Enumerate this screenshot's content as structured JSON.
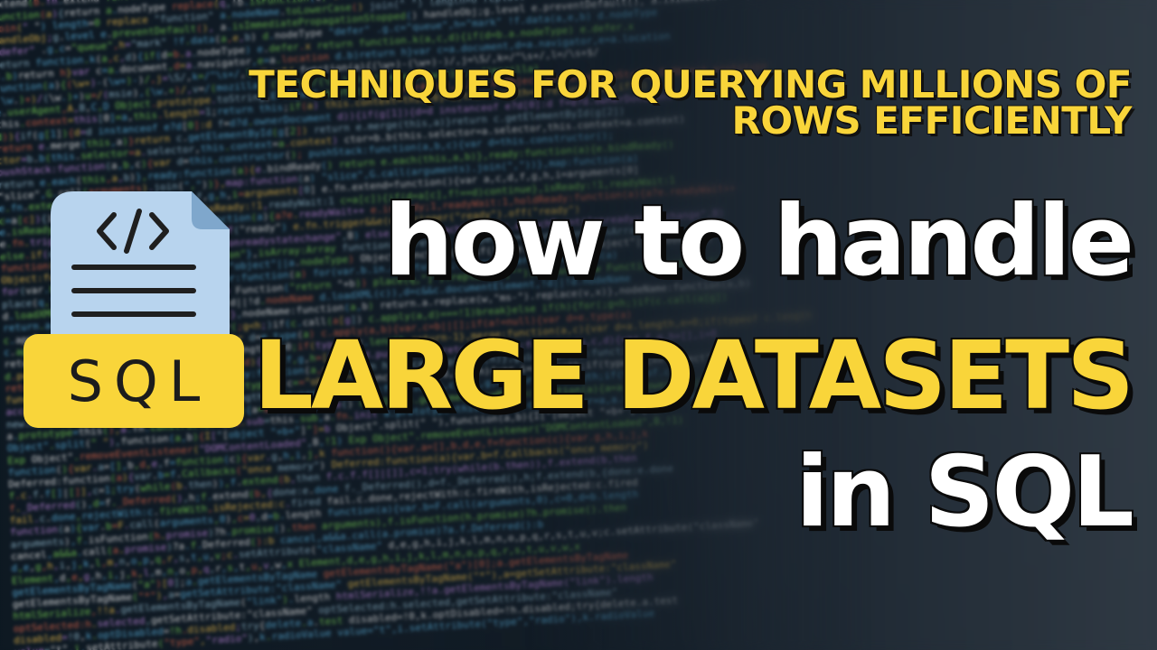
{
  "thumbnail": {
    "subtitle_line1": "TECHNIQUES FOR QUERYING MILLIONS OF",
    "subtitle_line2": "ROWS EFFICIENTLY",
    "title_line1": "how to handle",
    "title_line2": "LARGE DATASETS",
    "title_line3": "in SQL"
  },
  "icon": {
    "name": "sql-file-icon",
    "code_glyph": "</>",
    "label": "SQL"
  },
  "background": {
    "code_lines": [
      "ributes(b.?b.mergeAttributes b.defaultValue b.checked if(g)delete e.checked",
      "extend(b.fn.extend function(a){return a.appendChild a.handle e.events",
      "function(a){return a.nodeType replace(q,!b.isFunction(c) a.ownerDocument",
      "join(\" \") length=0 replace \"function\" a.nodeName.toLowerCase()",
      "handleObj;g.level e.preventDefault(), a.isImmediatePropagationStopped()",
      "\"defer\" .g.c=\"queue\",h=\"mark\" !f.data(a,e,b) d.nodeType",
      "return function.k(a,c,d){if(d=b.a.nodeType) e.defer.x",
      "d.b)return h}var c=a.document,d=a.navigator,e=a.location",
      "function(a){(\\w+)-(\\w+)-)/,j=\\S/,k=/^\\s+/,l=/\\s+$/",
      "(\\w.)+)/(\\w.)+)u=/(msie),(\\w.+)/,v=/(mozilla)",
      "e.userAgent,A,B,C,D Object.prototype.toString,E Object.prototype",
      "this.context=this[0]=a,this.length=1;return this;if(a)",
      "d)){if(g[1]){d=d instanceof e?d[0]:d f=d?d.ownerDocument",
      "return e.merge(this,a)}return c.getElementById(g[2])",
      "ctor=b.b(this.selector=a.selector,this.context=a.context)",
      "pushStack:function(a,b,c){var d=this.constructor();",
      "return e.each(this,a,b)},ready:function(a){e.bindReady()",
      "\"slice\",G.call(arguments).join(\",\"))},map:function(a)",
      "e.fn.extend=function(){var a,c,d,f,g,h,i=arguments[0]",
      "c=a[c]){if(d=a[c],f!==d)continue},isReady:!1,readyWait:1",
      "e.isReady;1,readyWait:1,holdReady:function(a){a?e.readyWait++",
      "e.fn.trigger&&e(c).trigger(\"ready\").off(\"ready\")",
      "else.if(c.attachEvent){c.attachEvent(\"onreadystatechange\",B)",
      "function(a){return e.type(a)===\"function\"},isArray:Array",
      "Object:function(a){if(!a||e.type(a)!==\"object\"||a.nodeType)",
      "for(var.b.in.a)return!1;return!0},error:function(a)",
      "place(q,\"]\").replace(r,\"\")))return(new Function(\"return \"+b))",
      "d.loadXML(c)),d=c&&c.documentElement,!d||!d.nodeName",
      "return.a.replace(w,\"ms-\").replace(v,x)},nodeName:function(a,b)",
      "c.apply(a,d)===!1)break}else if(h){for(;g<h;)if(c.call(a[g])",
      "c.apply(a,b){var.c=b||[];if(a!=null){var d=e.type(a)",
      "return-1},merge:function(a,c){var d=a.length,e=0;if(typeof c.length",
      "d.push(a[f]);return.d},map:function(a,c,d){var.f,g,h=[],i=0",
      "return h.concat.apply([],h)},guid:1,proxy:function(a,c)",
      "function(a,c,d,f,g,h){var.i=a.length;if(typeof c==\"object\")",
      "access:function(a,c,d,f,g,h){var.i=a.length;if(typeof.c",
      "new.Date).getTime()},uaMatch:function(a){a=a.toLowerCase()",
      "a.prototype=this(),a.fn.constructor=a,a.sub=this.sub,a.fn.init",
      "Object\".split(\" \"),function(a,b){I[\"[object \"+b+\"]\"]=b",
      "Exp Object\".removeEventListener(\"DOMContentLoaded\",B,!1)",
      "function(){var.a=[],b,d,e,f=function(c){var.g,h,i,j,k",
      "Deferred:function(a){var.b=f.Callbacks(\"once memory\")",
      "f.c.f.f[]|[]],c=1;try(while(b.then)),f.extend(b,then",
      "f._Deferred(),d=f._Deferred(),h;f.extend(b,{done:e.done",
      "fail.c.done,rejectWith:c.fireWith,isRejected:c.fired",
      "function(a){var.b=F.call(arguments,0),c=0,d=b.length",
      "arguments),f.isFunction(h.promise)?h.promise().then",
      "cancel,a&&a.call(a.promise)?a.f.Deferred():b",
      "d,e,g,h,i,j,k,l,m,n,o,p,q,r,s,t,u,v;c.setAttribute(\"className\"",
      "Element,d,e,g,h,i,j,k,l,m,n,o,p,q,r,s,t,u,v,w,x",
      "getElementsByTagName(\"a\")[0];a.getElementsByTagName",
      "getElementsByTagName(\"*\"),a=getSetAttribute:\"className\"",
      "htmlSerialize,!!a.getElementsByTagName(\"link\").length",
      "optSelected:h.selected,getSetAttribute:\"className\"",
      "disabled=!0,k.optDisabled=!h.disabled;try{delete.a.test",
      "value=\"t\",i.setAttribute(\"type\",\"radio\"),k.radioValue"
    ]
  }
}
